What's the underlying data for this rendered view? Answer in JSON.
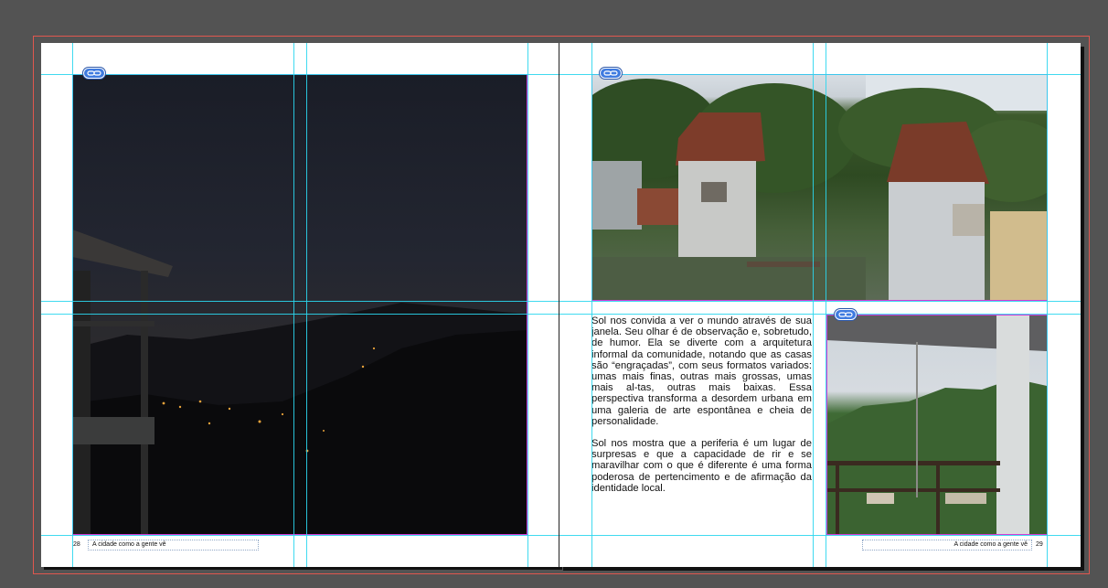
{
  "spread": {
    "left_page": {
      "page_number": "28",
      "running_footer": "A cidade como a gente vê"
    },
    "right_page": {
      "page_number": "29",
      "running_footer": "A cidade como a gente vê"
    }
  },
  "body_text": {
    "paragraph_1": "Sol nos convida a ver o mundo através de sua janela. Seu olhar é de observação e, sobretudo, de humor. Ela se diverte com a arquitetura informal da comunidade, notando que as casas são “engraçadas”, com seus formatos variados: umas mais finas, outras mais grossas, umas mais al-tas, outras mais baixas. Essa perspectiva transforma a desordem urbana em uma galeria de arte espontânea e cheia de personalidade.",
    "paragraph_2": "Sol nos mostra que a periferia é um lugar de surpresas e que a capacidade de rir e se maravilhar com o que é diferente é uma forma poderosa de pertencimento e de afirmação da identidade local."
  },
  "colors": {
    "pasteboard": "#535353",
    "guides": "#2bd6ee",
    "frame_edge": "#d63bd6",
    "bleed": "#e0574f",
    "link_badge": "#3f7be0"
  },
  "icons": [
    "link-icon"
  ]
}
